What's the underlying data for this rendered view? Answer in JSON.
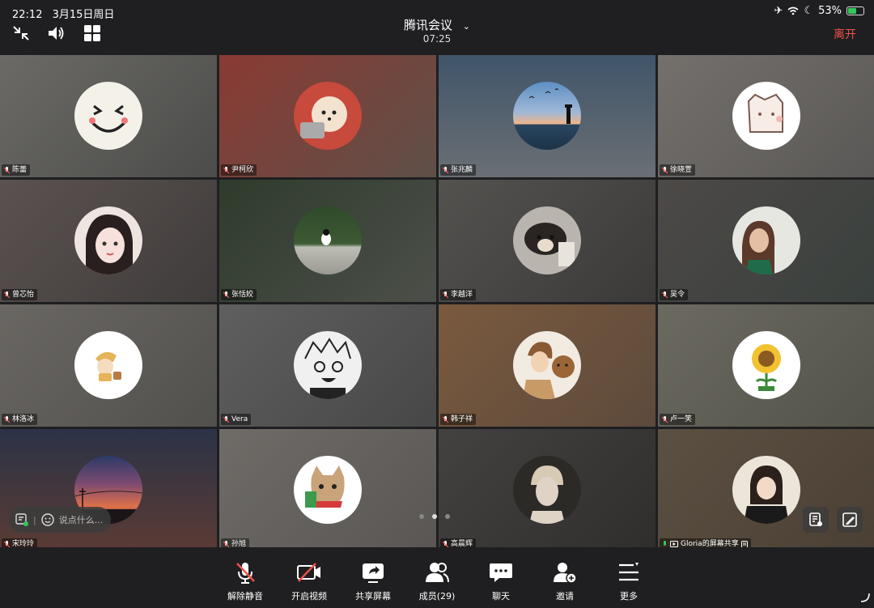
{
  "status_bar": {
    "time": "22:12",
    "date": "3月15日周日",
    "battery_percent": "53%"
  },
  "header": {
    "title": "腾讯会议",
    "elapsed": "07:25",
    "leave_label": "离开"
  },
  "participants": [
    {
      "name": "陈蕾",
      "avatar": "smiley-face"
    },
    {
      "name": "尹柯欣",
      "avatar": "pomeranian-dog"
    },
    {
      "name": "张兆麟",
      "avatar": "lighthouse-sunset"
    },
    {
      "name": "徐晓萱",
      "avatar": "cartoon-cat"
    },
    {
      "name": "曾芯怡",
      "avatar": "anime-girl"
    },
    {
      "name": "张恬姣",
      "avatar": "cat-on-grass"
    },
    {
      "name": "李越洋",
      "avatar": "puppy-photo"
    },
    {
      "name": "吴令",
      "avatar": "person-photo"
    },
    {
      "name": "林洛冰",
      "avatar": "cartoon-child"
    },
    {
      "name": "Vera",
      "avatar": "manga-character"
    },
    {
      "name": "韩子祥",
      "avatar": "boy-with-bear"
    },
    {
      "name": "卢一笑",
      "avatar": "sunflower"
    },
    {
      "name": "宋玲玲",
      "avatar": "sunset-sky"
    },
    {
      "name": "孙旭",
      "avatar": "cat-with-book"
    },
    {
      "name": "高晨辉",
      "avatar": "sketch-portrait"
    },
    {
      "name": "Gloria的屏幕共享",
      "avatar": "girl-photo"
    }
  ],
  "chat": {
    "placeholder": "说点什么..."
  },
  "pagination": {
    "pages": 3,
    "current": 2
  },
  "toolbar": {
    "mute_label": "解除静音",
    "video_label": "开启视频",
    "share_label": "共享屏幕",
    "members_label": "成员(29)",
    "chat_label": "聊天",
    "invite_label": "邀请",
    "more_label": "更多"
  },
  "colors": {
    "leave": "#f0524a",
    "background": "#1f1f21",
    "mic_on": "#34c759"
  }
}
